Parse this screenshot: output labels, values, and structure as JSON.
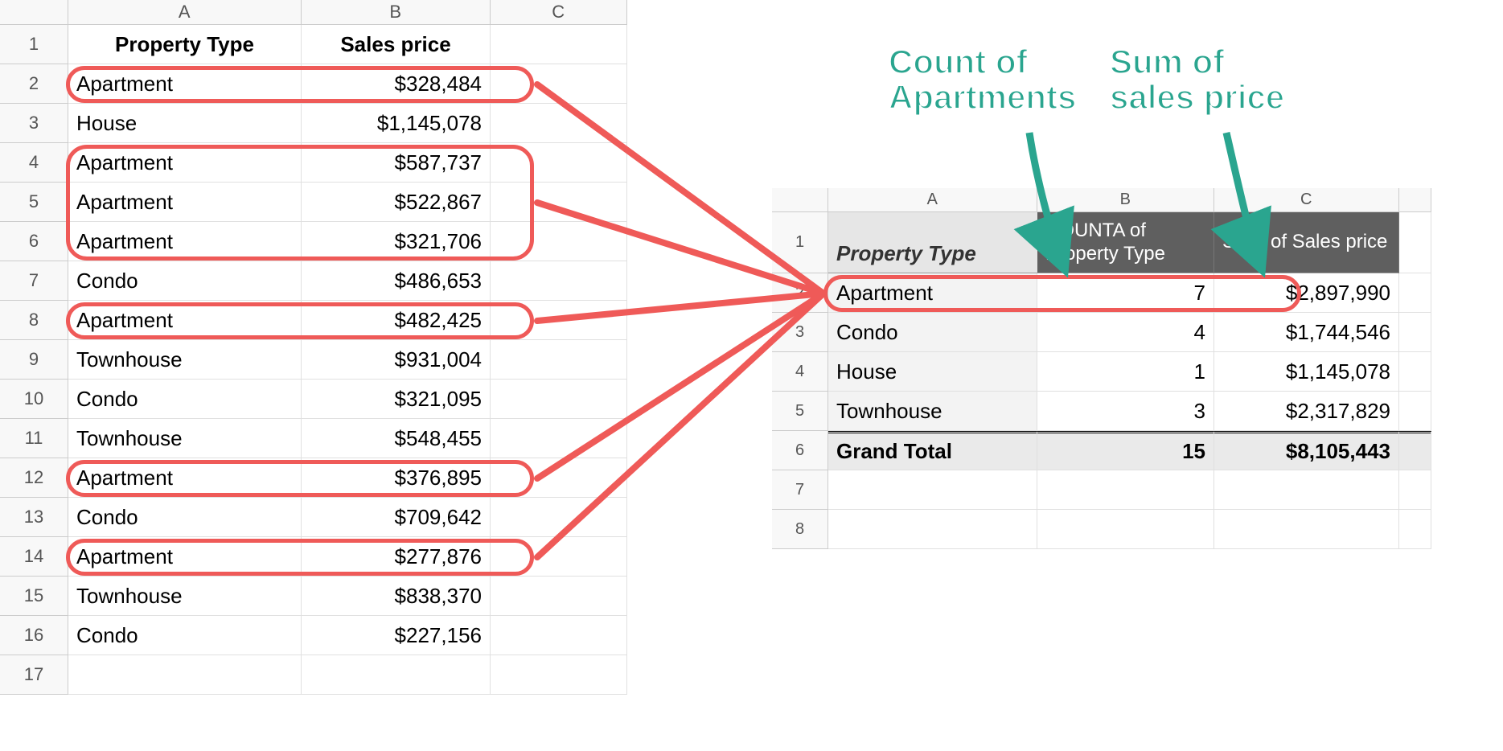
{
  "left_sheet": {
    "col_headers": [
      "A",
      "B",
      "C"
    ],
    "header_row": {
      "A": "Property Type",
      "B": "Sales price"
    },
    "rows": [
      {
        "n": "1"
      },
      {
        "n": "2",
        "A": "Apartment",
        "B": "$328,484"
      },
      {
        "n": "3",
        "A": "House",
        "B": "$1,145,078"
      },
      {
        "n": "4",
        "A": "Apartment",
        "B": "$587,737"
      },
      {
        "n": "5",
        "A": "Apartment",
        "B": "$522,867"
      },
      {
        "n": "6",
        "A": "Apartment",
        "B": "$321,706"
      },
      {
        "n": "7",
        "A": "Condo",
        "B": "$486,653"
      },
      {
        "n": "8",
        "A": "Apartment",
        "B": "$482,425"
      },
      {
        "n": "9",
        "A": "Townhouse",
        "B": "$931,004"
      },
      {
        "n": "10",
        "A": "Condo",
        "B": "$321,095"
      },
      {
        "n": "11",
        "A": "Townhouse",
        "B": "$548,455"
      },
      {
        "n": "12",
        "A": "Apartment",
        "B": "$376,895"
      },
      {
        "n": "13",
        "A": "Condo",
        "B": "$709,642"
      },
      {
        "n": "14",
        "A": "Apartment",
        "B": "$277,876"
      },
      {
        "n": "15",
        "A": "Townhouse",
        "B": "$838,370"
      },
      {
        "n": "16",
        "A": "Condo",
        "B": "$227,156"
      },
      {
        "n": "17",
        "A": "",
        "B": ""
      }
    ]
  },
  "right_sheet": {
    "col_headers": [
      "A",
      "B",
      "C",
      ""
    ],
    "row_numbers": [
      "1",
      "2",
      "3",
      "4",
      "5",
      "6",
      "7",
      "8"
    ],
    "pivot_header": {
      "row_label": "Property Type",
      "b": "COUNTA of Property Type",
      "c": "SUM of Sales price"
    },
    "pivot_rows": [
      {
        "label": "Apartment",
        "count": "7",
        "sum": "$2,897,990"
      },
      {
        "label": "Condo",
        "count": "4",
        "sum": "$1,744,546"
      },
      {
        "label": "House",
        "count": "1",
        "sum": "$1,145,078"
      },
      {
        "label": "Townhouse",
        "count": "3",
        "sum": "$2,317,829"
      }
    ],
    "grand_total": {
      "label": "Grand Total",
      "count": "15",
      "sum": "$8,105,443"
    }
  },
  "annotations": {
    "count_label": "Count of\nApartments",
    "sum_label": "Sum of\nsales price"
  },
  "chart_data": {
    "type": "table",
    "source_table": {
      "columns": [
        "Property Type",
        "Sales price"
      ],
      "rows": [
        [
          "Apartment",
          328484
        ],
        [
          "House",
          1145078
        ],
        [
          "Apartment",
          587737
        ],
        [
          "Apartment",
          522867
        ],
        [
          "Apartment",
          321706
        ],
        [
          "Condo",
          486653
        ],
        [
          "Apartment",
          482425
        ],
        [
          "Townhouse",
          931004
        ],
        [
          "Condo",
          321095
        ],
        [
          "Townhouse",
          548455
        ],
        [
          "Apartment",
          376895
        ],
        [
          "Condo",
          709642
        ],
        [
          "Apartment",
          277876
        ],
        [
          "Townhouse",
          838370
        ],
        [
          "Condo",
          227156
        ]
      ]
    },
    "pivot_table": {
      "row_field": "Property Type",
      "values": [
        {
          "field": "Property Type",
          "aggregate": "COUNTA"
        },
        {
          "field": "Sales price",
          "aggregate": "SUM"
        }
      ],
      "rows": [
        {
          "Property Type": "Apartment",
          "COUNTA of Property Type": 7,
          "SUM of Sales price": 2897990
        },
        {
          "Property Type": "Condo",
          "COUNTA of Property Type": 4,
          "SUM of Sales price": 1744546
        },
        {
          "Property Type": "House",
          "COUNTA of Property Type": 1,
          "SUM of Sales price": 1145078
        },
        {
          "Property Type": "Townhouse",
          "COUNTA of Property Type": 3,
          "SUM of Sales price": 2317829
        }
      ],
      "grand_total": {
        "COUNTA of Property Type": 15,
        "SUM of Sales price": 8105443
      }
    }
  }
}
